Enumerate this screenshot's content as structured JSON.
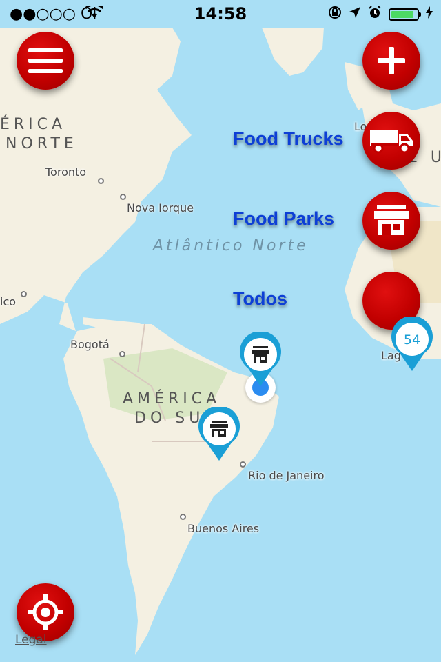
{
  "status_bar": {
    "carrier": "●●○○○ Oi",
    "time": "14:58",
    "battery_level": 0.9
  },
  "map": {
    "regions": [
      "ÉRICA",
      "NORTE",
      "AMÉRICA",
      "DO SUL"
    ],
    "ocean": "Atlântico Norte",
    "cities": {
      "toronto": "Toronto",
      "nova_iorque": "Nova Iorque",
      "bogota": "Bogotá",
      "rio": "Rio de Janeiro",
      "buenos_aires": "Buenos Aires",
      "mexico_partial": "ico",
      "europe_partial": "E U",
      "london_partial": "Lo",
      "lagos_partial": "Lag"
    },
    "cluster_count": "54",
    "legal": "Legal"
  },
  "menu": {
    "food_trucks": "Food Trucks",
    "food_parks": "Food Parks",
    "todos": "Todos"
  },
  "colors": {
    "button_red": "#c20000",
    "label_blue": "#0d3fd6",
    "pin_blue": "#1a9fd6",
    "water": "#a9dff5",
    "land": "#f4f0e2"
  },
  "icons": {
    "menu": "hamburger-icon",
    "add": "plus-icon",
    "truck": "truck-icon",
    "park": "storefront-icon",
    "locate": "crosshair-icon"
  }
}
